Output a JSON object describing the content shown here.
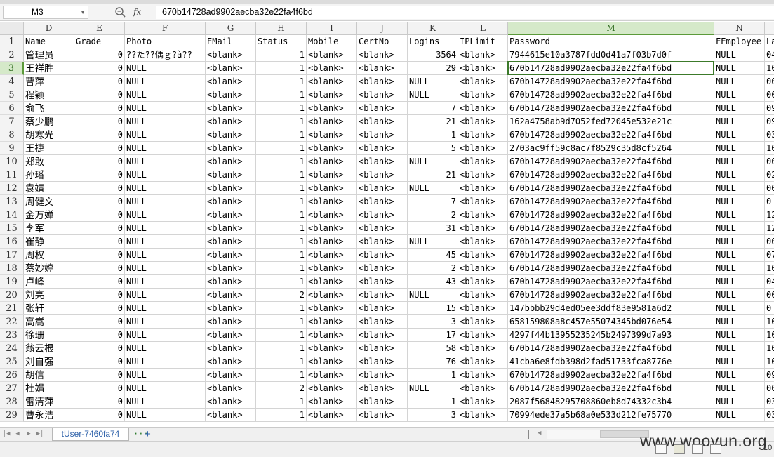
{
  "formula_bar": {
    "name_box": "M3",
    "fx": "fx",
    "formula": "670b14728ad9902aecba32e22fa4f6bd"
  },
  "columns": [
    {
      "letter": "D",
      "w": 72
    },
    {
      "letter": "E",
      "w": 72
    },
    {
      "letter": "F",
      "w": 115
    },
    {
      "letter": "G",
      "w": 72
    },
    {
      "letter": "H",
      "w": 72
    },
    {
      "letter": "I",
      "w": 72
    },
    {
      "letter": "J",
      "w": 72
    },
    {
      "letter": "K",
      "w": 72
    },
    {
      "letter": "L",
      "w": 71
    },
    {
      "letter": "M",
      "w": 294
    },
    {
      "letter": "N",
      "w": 72
    },
    {
      "letter": "",
      "w": 40
    }
  ],
  "selected_column": "M",
  "selected_row": "3",
  "rows": [
    {
      "n": "1",
      "c": [
        "Name",
        "Grade",
        "Photo",
        "EMail",
        "Status",
        "Mobile",
        "CertNo",
        "Logins",
        "IPLimit",
        "Password",
        "FEmployee",
        "La"
      ]
    },
    {
      "n": "2",
      "c": [
        "管理员",
        "0",
        "??た??偊ｇ?à??",
        "<blank>",
        "1",
        "<blank>",
        "<blank>",
        "3564",
        "<blank>",
        "7944615e10a3787fdd0d41a7f03b7d0f",
        "NULL",
        "04"
      ]
    },
    {
      "n": "3",
      "c": [
        "王祥胜",
        "0",
        "NULL",
        "<blank>",
        "1",
        "<blank>",
        "<blank>",
        "29",
        "<blank>",
        "670b14728ad9902aecba32e22fa4f6bd",
        "NULL",
        "10"
      ]
    },
    {
      "n": "4",
      "c": [
        "曹萍",
        "0",
        "NULL",
        "<blank>",
        "1",
        "<blank>",
        "<blank>",
        "NULL",
        "<blank>",
        "670b14728ad9902aecba32e22fa4f6bd",
        "NULL",
        "00"
      ]
    },
    {
      "n": "5",
      "c": [
        "程颖",
        "0",
        "NULL",
        "<blank>",
        "1",
        "<blank>",
        "<blank>",
        "NULL",
        "<blank>",
        "670b14728ad9902aecba32e22fa4f6bd",
        "NULL",
        "00"
      ]
    },
    {
      "n": "6",
      "c": [
        "俞飞",
        "0",
        "NULL",
        "<blank>",
        "1",
        "<blank>",
        "<blank>",
        "7",
        "<blank>",
        "670b14728ad9902aecba32e22fa4f6bd",
        "NULL",
        "09"
      ]
    },
    {
      "n": "7",
      "c": [
        "蔡少鹏",
        "0",
        "NULL",
        "<blank>",
        "1",
        "<blank>",
        "<blank>",
        "21",
        "<blank>",
        "162a4758ab9d7052fed72045e532e21c",
        "NULL",
        "09"
      ]
    },
    {
      "n": "8",
      "c": [
        "胡寒光",
        "0",
        "NULL",
        "<blank>",
        "1",
        "<blank>",
        "<blank>",
        "1",
        "<blank>",
        "670b14728ad9902aecba32e22fa4f6bd",
        "NULL",
        "03"
      ]
    },
    {
      "n": "9",
      "c": [
        "王捷",
        "0",
        "NULL",
        "<blank>",
        "1",
        "<blank>",
        "<blank>",
        "5",
        "<blank>",
        "2703ac9ff59c8ac7f8529c35d8cf5264",
        "NULL",
        "10"
      ]
    },
    {
      "n": "10",
      "c": [
        "郑敢",
        "0",
        "NULL",
        "<blank>",
        "1",
        "<blank>",
        "<blank>",
        "NULL",
        "<blank>",
        "670b14728ad9902aecba32e22fa4f6bd",
        "NULL",
        "00"
      ]
    },
    {
      "n": "11",
      "c": [
        "孙璠",
        "0",
        "NULL",
        "<blank>",
        "1",
        "<blank>",
        "<blank>",
        "21",
        "<blank>",
        "670b14728ad9902aecba32e22fa4f6bd",
        "NULL",
        "02"
      ]
    },
    {
      "n": "12",
      "c": [
        "袁婧",
        "0",
        "NULL",
        "<blank>",
        "1",
        "<blank>",
        "<blank>",
        "NULL",
        "<blank>",
        "670b14728ad9902aecba32e22fa4f6bd",
        "NULL",
        "00"
      ]
    },
    {
      "n": "13",
      "c": [
        "周健文",
        "0",
        "NULL",
        "<blank>",
        "1",
        "<blank>",
        "<blank>",
        "7",
        "<blank>",
        "670b14728ad9902aecba32e22fa4f6bd",
        "NULL",
        "0"
      ]
    },
    {
      "n": "14",
      "c": [
        "金万婵",
        "0",
        "NULL",
        "<blank>",
        "1",
        "<blank>",
        "<blank>",
        "2",
        "<blank>",
        "670b14728ad9902aecba32e22fa4f6bd",
        "NULL",
        "12"
      ]
    },
    {
      "n": "15",
      "c": [
        "李军",
        "0",
        "NULL",
        "<blank>",
        "1",
        "<blank>",
        "<blank>",
        "31",
        "<blank>",
        "670b14728ad9902aecba32e22fa4f6bd",
        "NULL",
        "12"
      ]
    },
    {
      "n": "16",
      "c": [
        "崔静",
        "0",
        "NULL",
        "<blank>",
        "1",
        "<blank>",
        "<blank>",
        "NULL",
        "<blank>",
        "670b14728ad9902aecba32e22fa4f6bd",
        "NULL",
        "00"
      ]
    },
    {
      "n": "17",
      "c": [
        "周权",
        "0",
        "NULL",
        "<blank>",
        "1",
        "<blank>",
        "<blank>",
        "45",
        "<blank>",
        "670b14728ad9902aecba32e22fa4f6bd",
        "NULL",
        "07"
      ]
    },
    {
      "n": "18",
      "c": [
        "蔡妙婷",
        "0",
        "NULL",
        "<blank>",
        "1",
        "<blank>",
        "<blank>",
        "2",
        "<blank>",
        "670b14728ad9902aecba32e22fa4f6bd",
        "NULL",
        "10"
      ]
    },
    {
      "n": "19",
      "c": [
        "卢峰",
        "0",
        "NULL",
        "<blank>",
        "1",
        "<blank>",
        "<blank>",
        "43",
        "<blank>",
        "670b14728ad9902aecba32e22fa4f6bd",
        "NULL",
        "04"
      ]
    },
    {
      "n": "20",
      "c": [
        "刘亮",
        "0",
        "NULL",
        "<blank>",
        "2",
        "<blank>",
        "<blank>",
        "NULL",
        "<blank>",
        "670b14728ad9902aecba32e22fa4f6bd",
        "NULL",
        "00"
      ]
    },
    {
      "n": "21",
      "c": [
        "张轩",
        "0",
        "NULL",
        "<blank>",
        "1",
        "<blank>",
        "<blank>",
        "15",
        "<blank>",
        "147bbbb29d4ed05ee3ddf83e9581a6d2",
        "NULL",
        "0"
      ]
    },
    {
      "n": "22",
      "c": [
        "高嵩",
        "0",
        "NULL",
        "<blank>",
        "1",
        "<blank>",
        "<blank>",
        "3",
        "<blank>",
        "658159808a8c457e55074345bd076e54",
        "NULL",
        "10"
      ]
    },
    {
      "n": "23",
      "c": [
        "徐珊",
        "0",
        "NULL",
        "<blank>",
        "1",
        "<blank>",
        "<blank>",
        "17",
        "<blank>",
        "4297f44b13955235245b2497399d7a93",
        "NULL",
        "10"
      ]
    },
    {
      "n": "24",
      "c": [
        "翁云根",
        "0",
        "NULL",
        "<blank>",
        "1",
        "<blank>",
        "<blank>",
        "58",
        "<blank>",
        "670b14728ad9902aecba32e22fa4f6bd",
        "NULL",
        "10"
      ]
    },
    {
      "n": "25",
      "c": [
        "刘自强",
        "0",
        "NULL",
        "<blank>",
        "1",
        "<blank>",
        "<blank>",
        "76",
        "<blank>",
        "41cba6e8fdb398d2fad51733fca8776e",
        "NULL",
        "10"
      ]
    },
    {
      "n": "26",
      "c": [
        "胡信",
        "0",
        "NULL",
        "<blank>",
        "1",
        "<blank>",
        "<blank>",
        "1",
        "<blank>",
        "670b14728ad9902aecba32e22fa4f6bd",
        "NULL",
        "09"
      ]
    },
    {
      "n": "27",
      "c": [
        "杜娟",
        "0",
        "NULL",
        "<blank>",
        "2",
        "<blank>",
        "<blank>",
        "NULL",
        "<blank>",
        "670b14728ad9902aecba32e22fa4f6bd",
        "NULL",
        "00"
      ]
    },
    {
      "n": "28",
      "c": [
        "雷清萍",
        "0",
        "NULL",
        "<blank>",
        "1",
        "<blank>",
        "<blank>",
        "1",
        "<blank>",
        "2087f56848295708860eb8d74332c3b4",
        "NULL",
        "03"
      ]
    },
    {
      "n": "29",
      "c": [
        "曹永浩",
        "0",
        "NULL",
        "<blank>",
        "1",
        "<blank>",
        "<blank>",
        "3",
        "<blank>",
        "70994ede37a5b68a0e533d212fe75770",
        "NULL",
        "03"
      ]
    }
  ],
  "sheet_tab": "tUser-7460fa74",
  "more_tabs": "···",
  "add_sheet": "+",
  "watermark": "www.wooyun.org",
  "zoom": "10",
  "colors": {
    "selected_header": "#d5e9c9",
    "accent": "#3c7a2a",
    "tab_text": "#2b5fa8"
  }
}
